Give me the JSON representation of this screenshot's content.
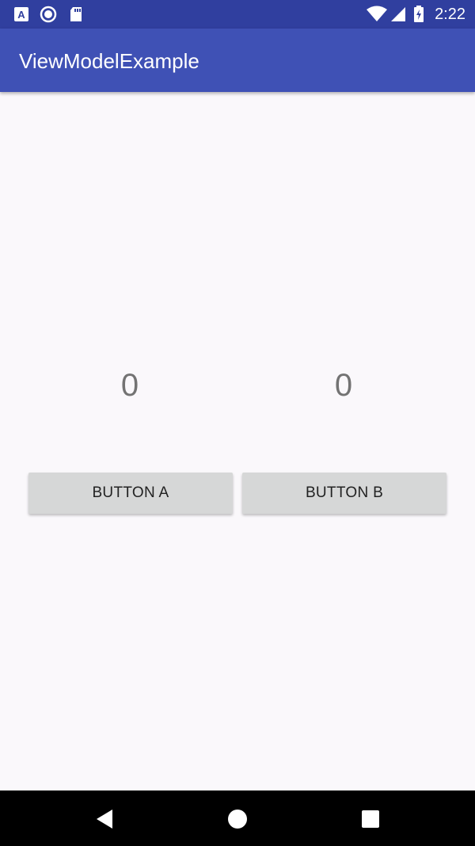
{
  "status_bar": {
    "time": "2:22",
    "icons": [
      "app-a-icon",
      "record-icon",
      "sd-card-icon",
      "wifi-icon",
      "signal-icon",
      "battery-charging-icon"
    ]
  },
  "app_bar": {
    "title": "ViewModelExample"
  },
  "counters": {
    "a_value": "0",
    "b_value": "0"
  },
  "buttons": {
    "a_label": "BUTTON A",
    "b_label": "BUTTON B"
  },
  "nav_bar": {
    "icons": [
      "back-icon",
      "home-icon",
      "recents-icon"
    ]
  },
  "colors": {
    "status_bar": "#303f9f",
    "app_bar": "#3f51b5",
    "background": "#faf8fb",
    "button": "#d6d7d7",
    "counter_text": "#737373"
  }
}
